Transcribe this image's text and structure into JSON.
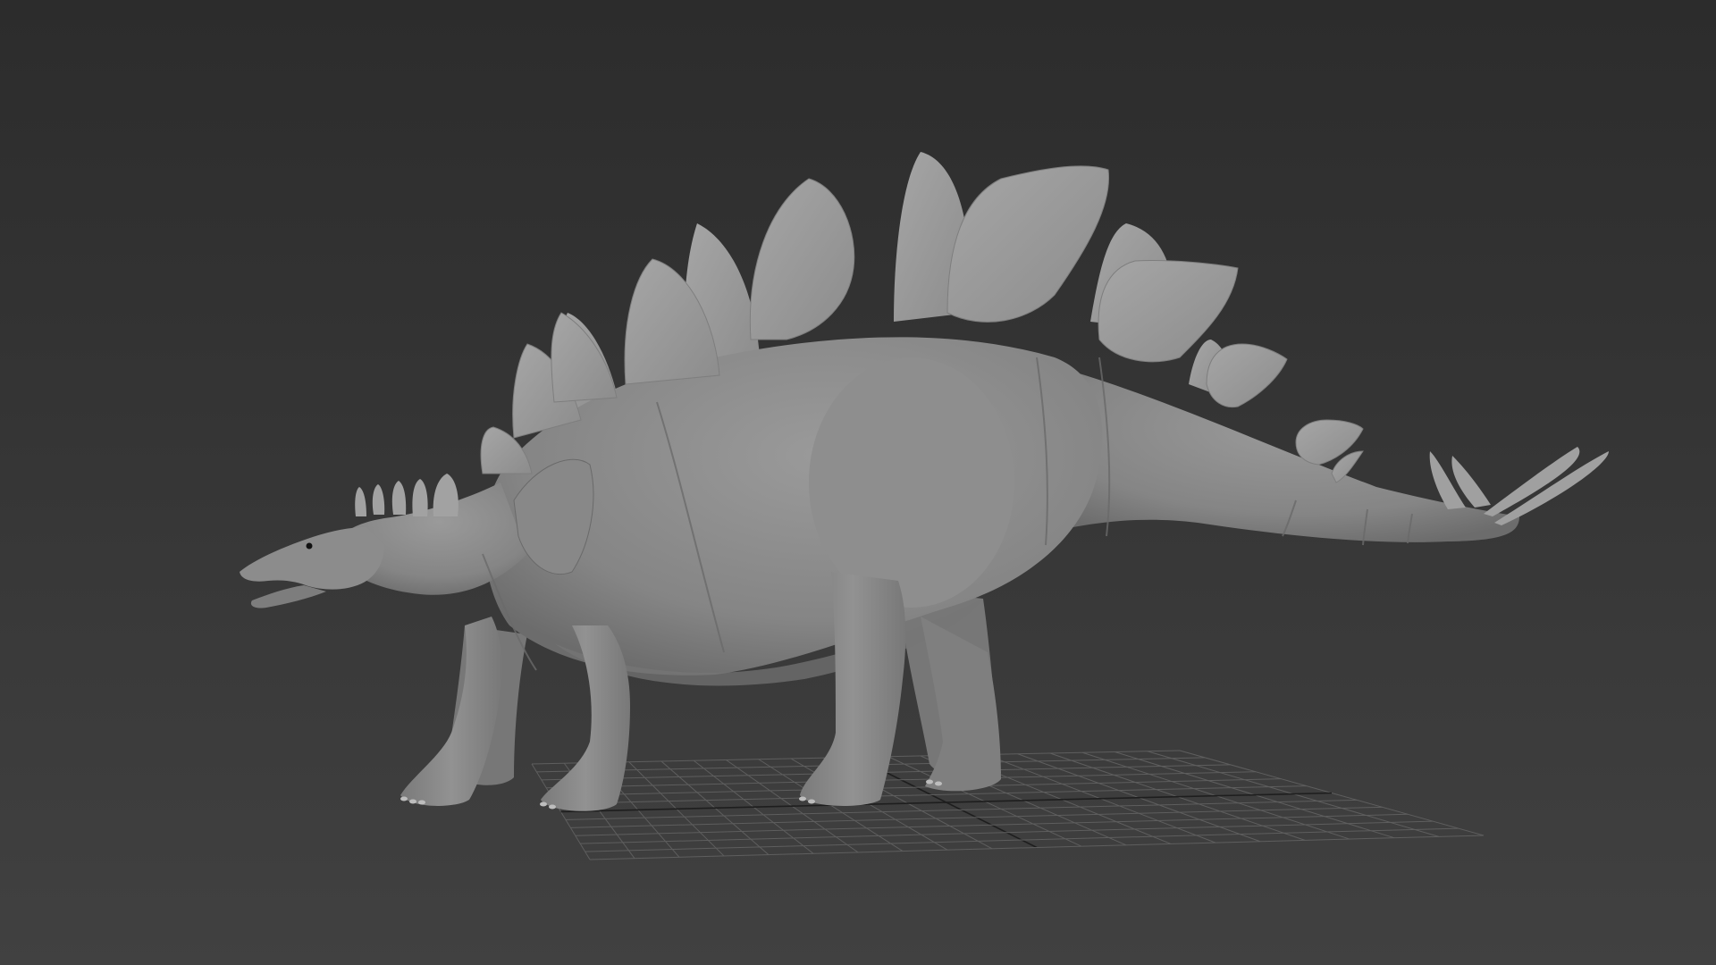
{
  "viewport": {
    "label": "",
    "background_top": "#2c2c2c",
    "background_bottom": "#414141",
    "grid_color": "#5e5e5e",
    "grid_axis_color": "#1e1e1e",
    "model_color": "#8a8a8a",
    "model_shadow_color": "#6e6e6e",
    "plate_color": "#9a9a9a"
  },
  "model": {
    "name": "stegosaurus-model",
    "material": "default-gray-clay"
  }
}
